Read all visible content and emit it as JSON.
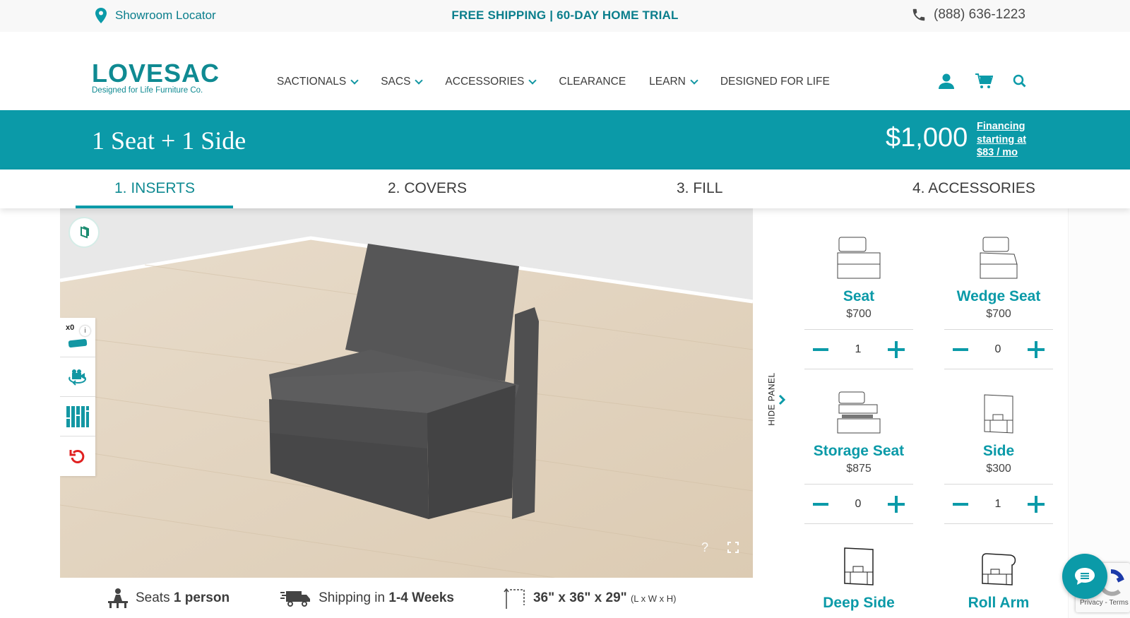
{
  "topbar": {
    "showroom_label": "Showroom Locator",
    "promo": "FREE SHIPPING | 60-DAY HOME TRIAL",
    "phone": "(888) 636-1223"
  },
  "header": {
    "logo_word": "LOVESAC",
    "logo_tagline": "Designed for Life Furniture Co.",
    "nav": [
      {
        "label": "SACTIONALS",
        "dropdown": true
      },
      {
        "label": "SACS",
        "dropdown": true
      },
      {
        "label": "ACCESSORIES",
        "dropdown": true
      },
      {
        "label": "CLEARANCE",
        "dropdown": false
      },
      {
        "label": "LEARN",
        "dropdown": true
      },
      {
        "label": "DESIGNED FOR LIFE",
        "dropdown": false
      }
    ],
    "icons": [
      "account-icon",
      "cart-icon",
      "search-icon"
    ]
  },
  "product": {
    "title": "1 Seat + 1 Side",
    "price": "$1,000",
    "financing": [
      "Financing",
      "starting at",
      "$83 / mo"
    ]
  },
  "tabs": [
    {
      "label": "1. INSERTS",
      "active": true
    },
    {
      "label": "2. COVERS",
      "active": false
    },
    {
      "label": "3. FILL",
      "active": false
    },
    {
      "label": "4. ACCESSORIES",
      "active": false
    }
  ],
  "viewer": {
    "toolbar": {
      "pillow_count": "x0",
      "info": "i"
    },
    "help": "?"
  },
  "specs": {
    "seats_prefix": "Seats ",
    "seats_value": "1 person",
    "shipping_prefix": "Shipping in ",
    "shipping_value": "1-4 Weeks",
    "dimensions": "36\" x 36\" x 29\"",
    "dimensions_note": "(L x W x H)"
  },
  "panel": {
    "hide_label": "HIDE PANEL",
    "items": [
      {
        "name": "Seat",
        "price": "$700",
        "qty": "1"
      },
      {
        "name": "Wedge Seat",
        "price": "$700",
        "qty": "0"
      },
      {
        "name": "Storage Seat",
        "price": "$875",
        "qty": "0"
      },
      {
        "name": "Side",
        "price": "$300",
        "qty": "1"
      },
      {
        "name": "Deep Side",
        "price": "",
        "qty": ""
      },
      {
        "name": "Roll Arm",
        "price": "",
        "qty": ""
      }
    ]
  },
  "recaptcha": {
    "text": "Privacy - Terms"
  },
  "colors": {
    "brand": "#0b9aa8",
    "brand_dark": "#0a7e8c",
    "undo": "#e02020"
  }
}
